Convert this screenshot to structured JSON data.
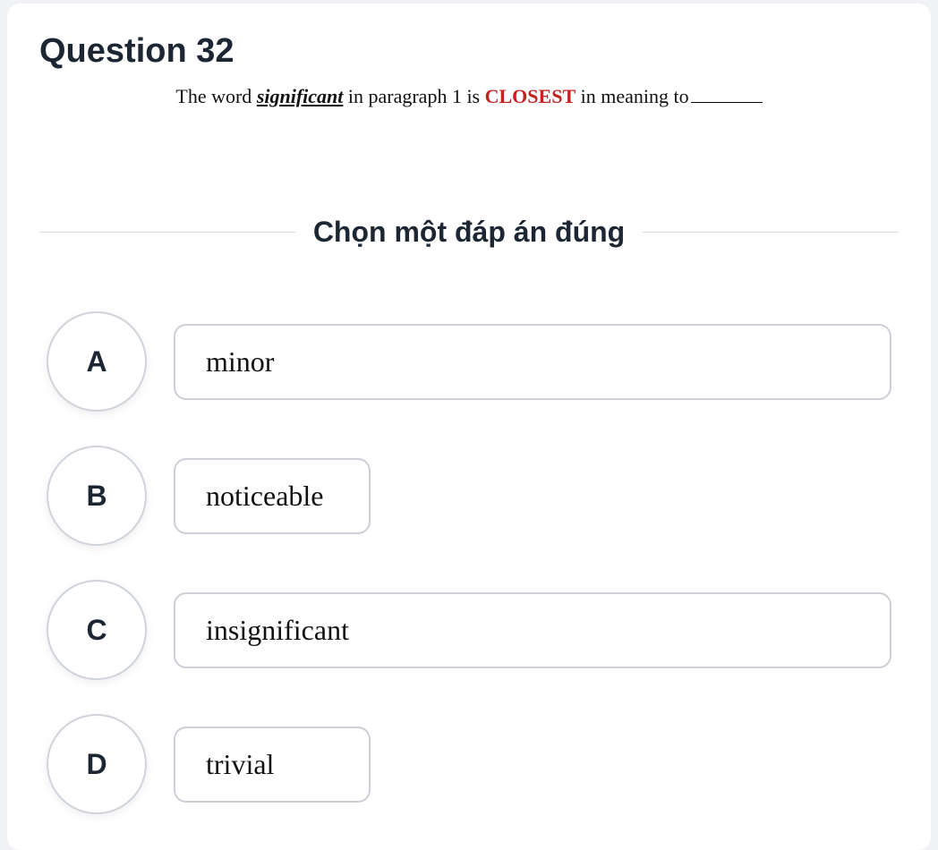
{
  "question": {
    "title": "Question 32",
    "prompt_pre": "The word ",
    "prompt_keyword": "significant",
    "prompt_mid": " in paragraph 1 is ",
    "prompt_highlight": "CLOSEST",
    "prompt_post": " in meaning to"
  },
  "instruction": "Chọn một đáp án đúng",
  "options": [
    {
      "letter": "A",
      "text": "minor",
      "width": "full"
    },
    {
      "letter": "B",
      "text": "noticeable",
      "width": "fit"
    },
    {
      "letter": "C",
      "text": "insignificant",
      "width": "full"
    },
    {
      "letter": "D",
      "text": "trivial",
      "width": "fit"
    }
  ]
}
